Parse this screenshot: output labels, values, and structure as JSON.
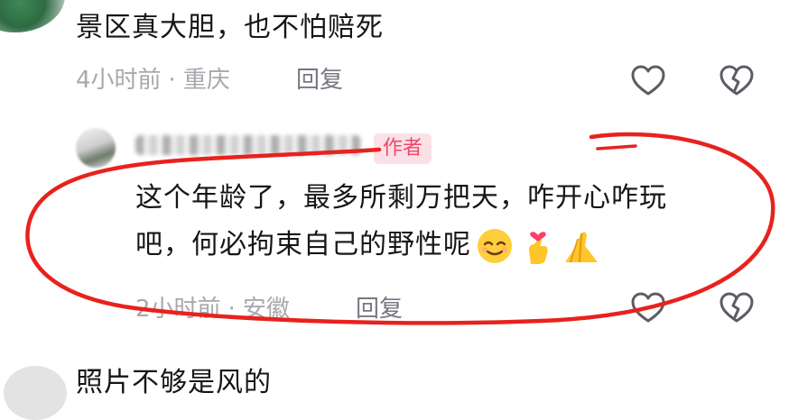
{
  "comments": [
    {
      "text": "景区真大胆，也不怕赔死",
      "time": "4小时前",
      "location": "重庆",
      "reply_label": "回复"
    },
    {
      "author_badge": "作者",
      "text_line1": "这个年龄了，最多所剩万把天，咋开心咋玩",
      "text_line2": "吧，何必拘束自己的野性呢",
      "emojis": [
        "smiling-face-emoji",
        "finger-heart-emoji",
        "pray-emoji"
      ],
      "time": "2小时前",
      "location": "安徽",
      "reply_label": "回复"
    },
    {
      "text": "照片不够是风的"
    }
  ],
  "separator": "·",
  "colors": {
    "annotation": "#e8221d",
    "author_badge_bg": "#fbe1e6",
    "author_badge_text": "#f0466d",
    "meta_text": "#a8a8ae"
  }
}
